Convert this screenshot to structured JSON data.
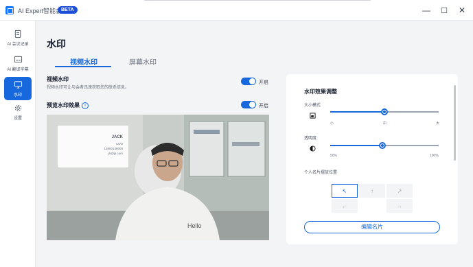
{
  "app": {
    "title": "AI Expert智能会议",
    "badge": "BETA"
  },
  "window_controls": {
    "minimize": "—",
    "maximize": "☐",
    "close": "✕"
  },
  "sidebar": {
    "items": [
      {
        "label": "AI 会议记录",
        "icon": "document-icon"
      },
      {
        "label": "AI 翻译字幕",
        "icon": "subtitle-icon"
      },
      {
        "label": "水印",
        "icon": "monitor-icon",
        "active": true
      },
      {
        "label": "设置",
        "icon": "gear-icon"
      }
    ]
  },
  "main": {
    "title": "水印",
    "tabs": [
      {
        "label": "视频水印",
        "active": true
      },
      {
        "label": "屏幕水印",
        "active": false
      }
    ],
    "video_watermark": {
      "title": "视频水印",
      "description": "视频水印可让与会者迅速获取您的联系信息。",
      "toggle_label": "开启",
      "enabled": true
    },
    "preview": {
      "title": "预览水印效果",
      "info_icon": "i",
      "toggle_label": "开启",
      "enabled": true,
      "card": {
        "name": "JACK",
        "role": "COO",
        "phone": "13800138000",
        "email": "jk@jk.com"
      },
      "shirt_text": "Hello"
    }
  },
  "panel": {
    "title": "水印效果调整",
    "size": {
      "label": "大小模式",
      "ticks": [
        "小",
        "中",
        "大"
      ],
      "value_fraction": 0.5
    },
    "opacity": {
      "label": "透明度",
      "ticks": [
        "50%",
        "100%"
      ],
      "value_fraction": 0.48
    },
    "position": {
      "label": "个人名片摆放位置",
      "cells": [
        "↖",
        "↑",
        "↗",
        "←",
        "",
        "→"
      ],
      "selected": 0
    },
    "edit_button": "编辑名片"
  },
  "colors": {
    "accent": "#1668dc",
    "background": "#f3f4f6",
    "panel": "#ffffff"
  }
}
